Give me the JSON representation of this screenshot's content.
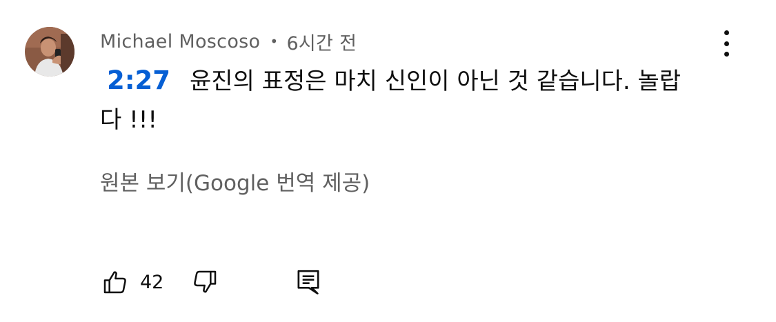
{
  "comment": {
    "author": "Michael Moscoso",
    "separator": "•",
    "time_ago": "6시간 전",
    "timestamp_link": "2:27",
    "text": "윤진의 표정은 마치 신인이 아닌 것 같습니다. 놀랍다 !!!",
    "translation_toggle": "원본 보기(Google 번역 제공)"
  },
  "actions": {
    "like_count": "42",
    "like_icon": "thumbs-up-icon",
    "dislike_icon": "thumbs-down-icon",
    "reply_icon": "reply-comment-icon",
    "more_icon": "more-vertical-icon"
  },
  "colors": {
    "link_blue": "#065fd4",
    "secondary_text": "#606060",
    "primary_text": "#0f0f0f"
  }
}
